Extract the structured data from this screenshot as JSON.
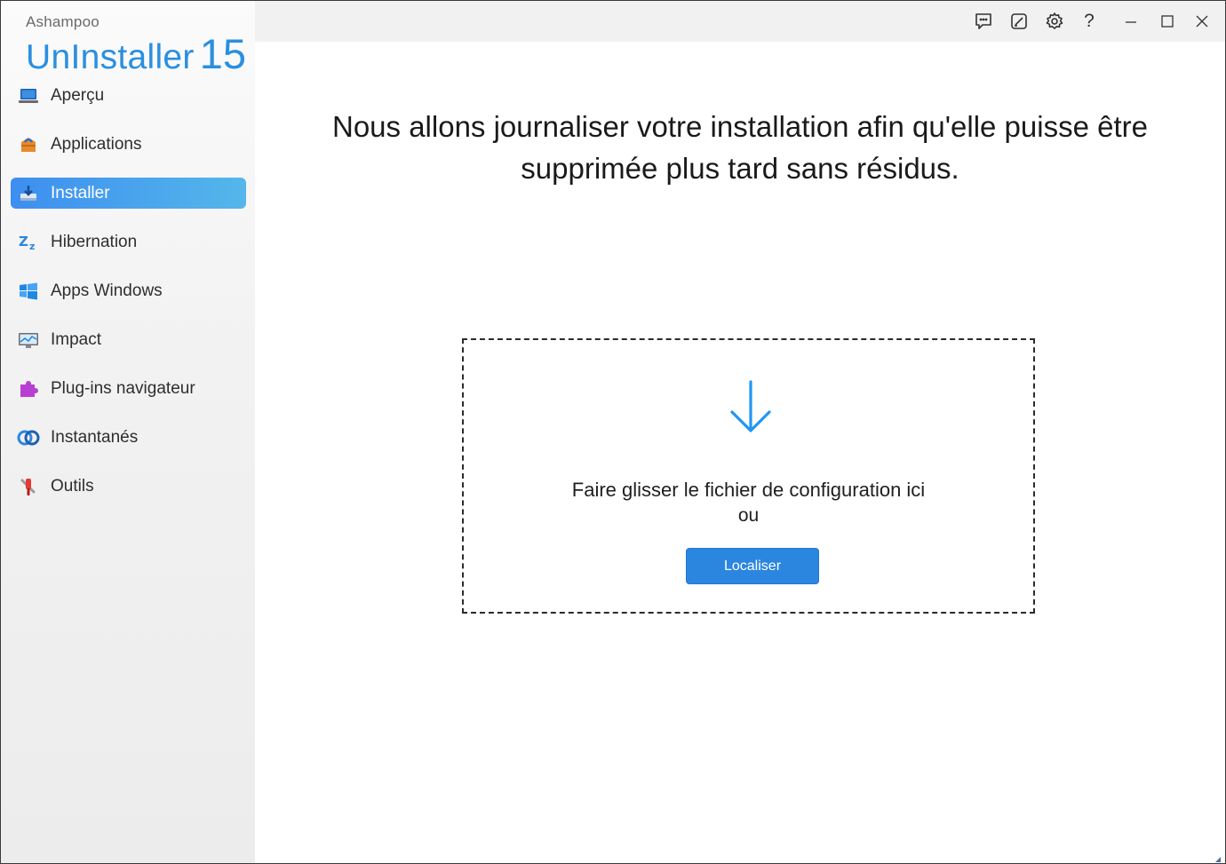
{
  "brand": {
    "top": "Ashampoo",
    "name": "UnInstaller",
    "version": "15"
  },
  "sidebar": {
    "items": [
      {
        "label": "Aperçu",
        "icon": "laptop-icon",
        "active": false
      },
      {
        "label": "Applications",
        "icon": "package-icon",
        "active": false
      },
      {
        "label": "Installer",
        "icon": "install-download-icon",
        "active": true
      },
      {
        "label": "Hibernation",
        "icon": "sleep-zz-icon",
        "active": false
      },
      {
        "label": "Apps Windows",
        "icon": "windows-logo-icon",
        "active": false
      },
      {
        "label": "Impact",
        "icon": "monitor-chart-icon",
        "active": false
      },
      {
        "label": "Plug-ins navigateur",
        "icon": "puzzle-plugin-icon",
        "active": false
      },
      {
        "label": "Instantanés",
        "icon": "snapshot-rings-icon",
        "active": false
      },
      {
        "label": "Outils",
        "icon": "tools-icon",
        "active": false
      }
    ]
  },
  "titlebar": {
    "buttons": [
      "feedback-icon",
      "edit-note-icon",
      "settings-gear-icon",
      "help-icon",
      "minimize-icon",
      "maximize-icon",
      "close-icon"
    ],
    "help_glyph": "?"
  },
  "main": {
    "headline": "Nous allons journaliser votre installation afin qu'elle puisse être supprimée plus tard sans résidus.",
    "dropzone": {
      "text": "Faire glisser le fichier de configuration ici",
      "or": "ou",
      "button": "Localiser"
    }
  },
  "colors": {
    "accent": "#2b86e0",
    "active_gradient_start": "#3d8ef0",
    "active_gradient_end": "#54b7ea",
    "brand": "#2a8fe0",
    "arrow": "#2196f3"
  }
}
